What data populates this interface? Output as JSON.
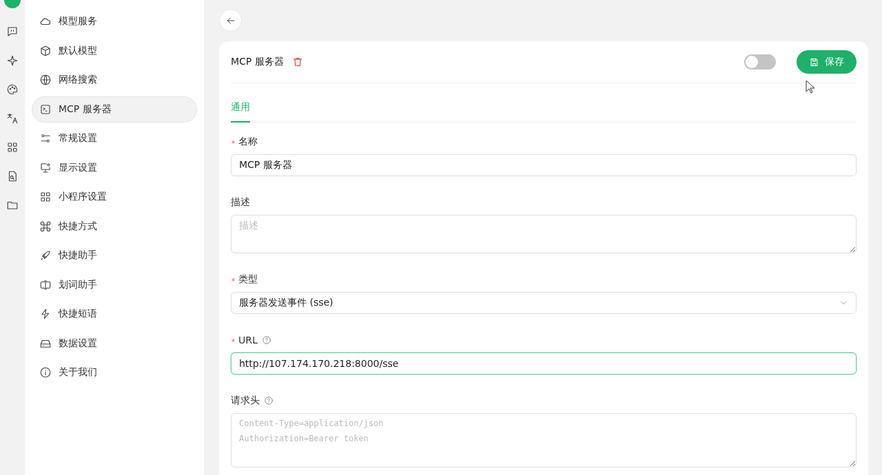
{
  "sidebar": {
    "items": [
      {
        "label": "模型服务",
        "selected": false
      },
      {
        "label": "默认模型",
        "selected": false
      },
      {
        "label": "网络搜索",
        "selected": false
      },
      {
        "label": "MCP 服务器",
        "selected": true
      },
      {
        "label": "常规设置",
        "selected": false
      },
      {
        "label": "显示设置",
        "selected": false
      },
      {
        "label": "小程序设置",
        "selected": false
      },
      {
        "label": "快捷方式",
        "selected": false
      },
      {
        "label": "快捷助手",
        "selected": false
      },
      {
        "label": "划词助手",
        "selected": false
      },
      {
        "label": "快捷短语",
        "selected": false
      },
      {
        "label": "数据设置",
        "selected": false
      },
      {
        "label": "关于我们",
        "selected": false
      }
    ]
  },
  "server": {
    "title": "MCP 服务器",
    "enabled": false,
    "save_label": "保存"
  },
  "tabs": [
    {
      "label": "通用",
      "selected": true
    }
  ],
  "fields": [
    {
      "kind": "input",
      "label": "名称",
      "required": true,
      "help": false,
      "value": "MCP 服务器",
      "focused": false
    },
    {
      "kind": "textarea",
      "label": "描述",
      "required": false,
      "help": false,
      "placeholder": "描述",
      "focused": false
    },
    {
      "kind": "select",
      "label": "类型",
      "required": true,
      "help": false,
      "value": "服务器发送事件 (sse)",
      "focused": false
    },
    {
      "kind": "input",
      "label": "URL",
      "required": true,
      "help": true,
      "value": "http://107.174.170.218:8000/sse",
      "focused": true
    },
    {
      "kind": "code",
      "label": "请求头",
      "required": false,
      "help": true,
      "placeholder": "Content-Type=application/json\nAuthorization=Bearer token",
      "focused": false
    }
  ]
}
